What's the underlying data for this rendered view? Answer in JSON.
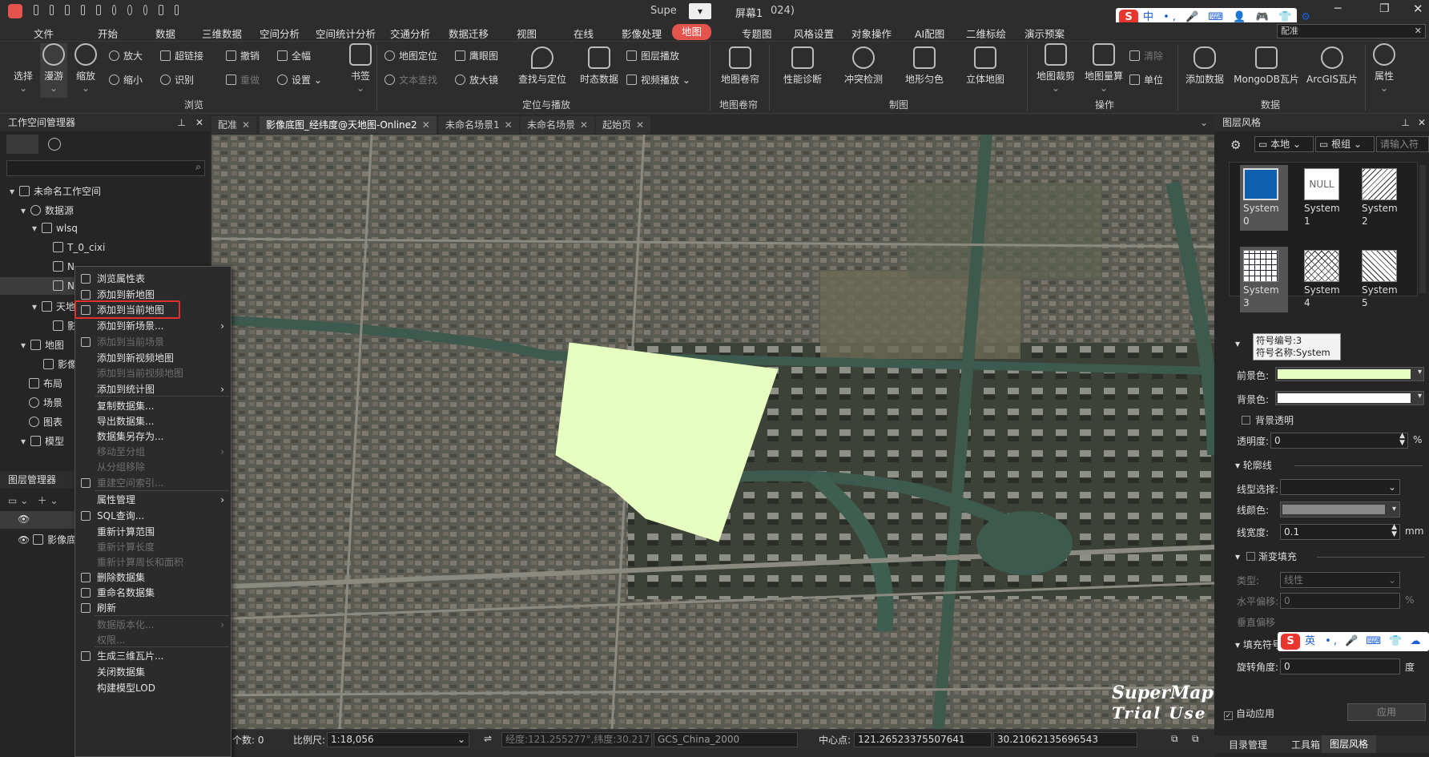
{
  "title": {
    "app": "Supe",
    "screen": "屏幕1",
    "year": "024)"
  },
  "menu": [
    "文件",
    "开始",
    "数据",
    "三维数据",
    "空间分析",
    "空间统计分析",
    "交通分析",
    "数据迁移",
    "视图",
    "在线",
    "影像处理",
    "地图",
    "专题图",
    "风格设置",
    "对象操作",
    "AI配图",
    "二维标绘",
    "演示预案"
  ],
  "ribbon": {
    "browse": {
      "select": "选择",
      "pan": "漫游",
      "zoom": "缩放",
      "zoom_in": "放大",
      "zoom_out": "缩小",
      "hyperlink": "超链接",
      "identify": "识别",
      "undo": "撤销",
      "redo": "重做",
      "full_extent": "全幅",
      "settings": "设置",
      "bookmark": "书签",
      "group": "浏览"
    },
    "locate": {
      "map_locate": "地图定位",
      "text_search": "文本查找",
      "eagle_eye": "鹰眼图",
      "magnifier": "放大镜",
      "find_locate": "查找与定位",
      "temporal": "时态数据",
      "layer_play": "图层播放",
      "video_play": "视频播放",
      "group": "定位与播放"
    },
    "swipe": {
      "label": "地图卷帘",
      "group": "地图卷帘"
    },
    "cartography": {
      "perf": "性能诊断",
      "conflict": "冲突检测",
      "terrain": "地形匀色",
      "solid": "立体地图",
      "group": "制图"
    },
    "ops": {
      "clip": "地图裁剪",
      "measure": "地图量算",
      "clear": "清除",
      "unit": "单位",
      "group": "操作"
    },
    "data": {
      "add_data": "添加数据",
      "mongodb": "MongoDB瓦片",
      "arcgis": "ArcGIS瓦片",
      "group": "数据"
    },
    "attr": "属性"
  },
  "tabs": [
    "配准",
    "影像底图_经纬度@天地图-Online2",
    "未命名场景1",
    "未命名场景",
    "起始页"
  ],
  "workspace": {
    "title": "工作空间管理器",
    "tree": [
      "未命名工作空间",
      "数据源",
      "wlsq",
      "T_0_cixi",
      "N",
      "N",
      "天地",
      "影",
      "地图",
      "影像",
      "布局",
      "场景",
      "图表",
      "模型"
    ],
    "layer_title": "图层管理器",
    "layers": [
      "影像底"
    ]
  },
  "context_menu": [
    {
      "label": "浏览属性表",
      "disabled": false,
      "sub": false
    },
    {
      "label": "添加到新地图",
      "disabled": false,
      "sub": false
    },
    {
      "label": "添加到当前地图",
      "disabled": false,
      "sub": false
    },
    {
      "label": "添加到新场景...",
      "disabled": false,
      "sub": true
    },
    {
      "label": "添加到当前场景",
      "disabled": true,
      "sub": false
    },
    {
      "label": "添加到新视频地图",
      "disabled": false,
      "sub": false
    },
    {
      "label": "添加到当前视频地图",
      "disabled": true,
      "sub": false
    },
    {
      "label": "添加到统计图",
      "disabled": false,
      "sub": true
    },
    {
      "label": "复制数据集...",
      "disabled": false,
      "sub": false
    },
    {
      "label": "导出数据集...",
      "disabled": false,
      "sub": false
    },
    {
      "label": "数据集另存为...",
      "disabled": false,
      "sub": false
    },
    {
      "label": "移动至分组",
      "disabled": true,
      "sub": true
    },
    {
      "label": "从分组移除",
      "disabled": true,
      "sub": false
    },
    {
      "label": "重建空间索引...",
      "disabled": true,
      "sub": false
    },
    {
      "label": "属性管理",
      "disabled": false,
      "sub": true
    },
    {
      "label": "SQL查询...",
      "disabled": false,
      "sub": false
    },
    {
      "label": "重新计算范围",
      "disabled": false,
      "sub": false
    },
    {
      "label": "重新计算长度",
      "disabled": true,
      "sub": false
    },
    {
      "label": "重新计算周长和面积",
      "disabled": true,
      "sub": false
    },
    {
      "label": "删除数据集",
      "disabled": false,
      "sub": false
    },
    {
      "label": "重命名数据集",
      "disabled": false,
      "sub": false
    },
    {
      "label": "刷新",
      "disabled": false,
      "sub": false
    },
    {
      "label": "数据版本化...",
      "disabled": true,
      "sub": true
    },
    {
      "label": "权限...",
      "disabled": true,
      "sub": false
    },
    {
      "label": "生成三维瓦片...",
      "disabled": false,
      "sub": false
    },
    {
      "label": "关闭数据集",
      "disabled": false,
      "sub": false
    },
    {
      "label": "构建模型LOD",
      "disabled": false,
      "sub": false
    }
  ],
  "status": {
    "count_label": "个数:",
    "count": "0",
    "scale_label": "比例尺:",
    "scale": "1:18,056",
    "coord": "经度:121.255277°,纬度:30.217187",
    "crs": "GCS_China_2000",
    "center_label": "中心点:",
    "center_x": "121.26523375507641",
    "center_y": "30.21062135696543"
  },
  "watermark": {
    "line1": "SuperMap",
    "line2": "Trial Use"
  },
  "style_panel": {
    "title": "图层风格",
    "source": "本地",
    "group": "根组",
    "search_placeholder": "请输入符",
    "symbols": [
      {
        "name": "System",
        "id": "0"
      },
      {
        "name": "NULL",
        "id": "1",
        "label": "System"
      },
      {
        "name": "System",
        "id": "2"
      },
      {
        "name": "System",
        "id": "3"
      },
      {
        "name": "System",
        "id": "4"
      },
      {
        "name": "System",
        "id": "5"
      }
    ],
    "tooltip": {
      "code": "符号编号:3",
      "name": "符号名称:System 3"
    },
    "fg_label": "前景色:",
    "fg_color": "#e6ffc0",
    "bg_label": "背景色:",
    "bg_color": "#ffffff",
    "bg_transparent": "背景透明",
    "opacity_label": "透明度:",
    "opacity": "0",
    "pct": "%",
    "outline": "轮廓线",
    "line_type": "线型选择:",
    "line_color": "线颜色:",
    "line_width": "线宽度:",
    "line_width_val": "0.1",
    "mm": "mm",
    "gradient": "渐变填充",
    "type_label": "类型:",
    "type_val": "线性",
    "h_offset": "水平偏移:",
    "h_offset_val": "0",
    "v_offset": "垂直偏移",
    "rotate_section": "填充符号旋转角度",
    "rotate_label": "旋转角度:",
    "rotate_val": "0",
    "deg": "度",
    "auto_apply": "自动应用",
    "apply": "应用",
    "bottom_tabs": [
      "目录管理",
      "工具箱",
      "图层风格"
    ]
  },
  "ime": {
    "top": "中",
    "bottom": "英",
    "color": "#e8352d"
  },
  "title_search": "配准"
}
